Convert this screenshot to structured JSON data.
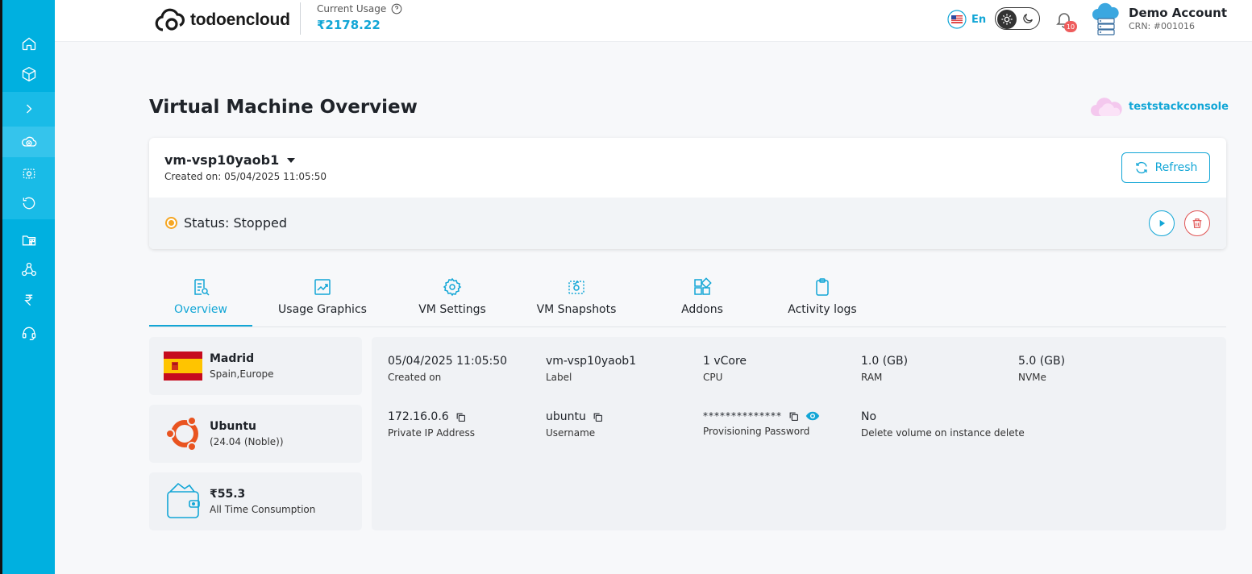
{
  "topbar": {
    "brand": "todoencloud",
    "usage_label": "Current Usage",
    "usage_value": "₹2178.22",
    "language": "En",
    "notification_count": "10",
    "account_name": "Demo Account",
    "account_crn": "CRN: #001016"
  },
  "sidebar": {
    "items": [
      {
        "icon": "home-icon"
      },
      {
        "icon": "cube-icon"
      },
      {
        "icon": "chevron-right-icon"
      },
      {
        "icon": "cloud-add-icon"
      },
      {
        "icon": "snapshot-icon"
      },
      {
        "icon": "history-icon"
      },
      {
        "icon": "folder-icon"
      },
      {
        "icon": "network-icon"
      },
      {
        "icon": "rupee-icon"
      },
      {
        "icon": "headset-icon"
      }
    ]
  },
  "page": {
    "title": "Virtual Machine Overview",
    "console_name": "teststackconsole"
  },
  "vm": {
    "name": "vm-vsp10yaob1",
    "created": "Created on: 05/04/2025 11:05:50",
    "refresh_label": "Refresh",
    "status": "Status: Stopped"
  },
  "tabs": [
    {
      "label": "Overview",
      "icon": "overview-icon",
      "active": true
    },
    {
      "label": "Usage Graphics",
      "icon": "chart-icon",
      "active": false
    },
    {
      "label": "VM Settings",
      "icon": "gear-icon",
      "active": false
    },
    {
      "label": "VM Snapshots",
      "icon": "snapshot-icon",
      "active": false
    },
    {
      "label": "Addons",
      "icon": "addons-icon",
      "active": false
    },
    {
      "label": "Activity logs",
      "icon": "clipboard-icon",
      "active": false
    }
  ],
  "cards": {
    "location": {
      "title": "Madrid",
      "subtitle": "Spain,Europe"
    },
    "os": {
      "title": "Ubuntu",
      "subtitle": "(24.04 (Noble))"
    },
    "consumption": {
      "title": "₹55.3",
      "subtitle": "All Time Consumption"
    }
  },
  "details": {
    "created_on": {
      "value": "05/04/2025 11:05:50",
      "label": "Created on"
    },
    "vm_label": {
      "value": "vm-vsp10yaob1",
      "label": "Label"
    },
    "cpu": {
      "value": "1 vCore",
      "label": "CPU"
    },
    "ram": {
      "value": "1.0 (GB)",
      "label": "RAM"
    },
    "nvme": {
      "value": "5.0 (GB)",
      "label": "NVMe"
    },
    "private_ip": {
      "value": "172.16.0.6",
      "label": "Private IP Address"
    },
    "username": {
      "value": "ubuntu",
      "label": "Username"
    },
    "password": {
      "value": "**************",
      "label": "Provisioning Password"
    },
    "delete_volume": {
      "value": "No",
      "label": "Delete volume on instance delete"
    }
  },
  "colors": {
    "accent": "#12a6d6",
    "sidebar": "#00b0e0",
    "status_stopped": "#f5a623",
    "danger": "#e05353"
  }
}
